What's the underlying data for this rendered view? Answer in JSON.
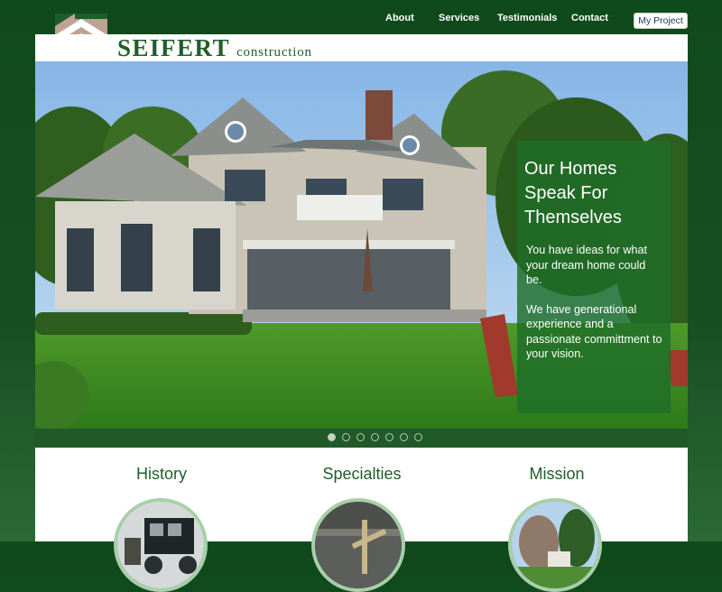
{
  "brand": {
    "name": "SEIFERT",
    "tagline": "construction",
    "logo_icon": "roof-logo-icon",
    "colors": {
      "primary_green": "#1f5f2a",
      "logo_tan": "#bfa392"
    }
  },
  "nav": {
    "items": [
      {
        "label": "About"
      },
      {
        "label": "Services"
      },
      {
        "label": "Testimonials"
      },
      {
        "label": "Contact"
      }
    ],
    "project_button": "My Project"
  },
  "hero": {
    "title": "Our Homes Speak For Themselves",
    "paragraph1": "You have ideas for what your dream home could be.",
    "paragraph2": "We have generational experience and a passionate committment to your vision.",
    "slides": {
      "count": 7,
      "active_index": 0
    }
  },
  "sections": [
    {
      "title": "History",
      "image": "vintage-truck-photo"
    },
    {
      "title": "Specialties",
      "image": "woodwork-photo"
    },
    {
      "title": "Mission",
      "image": "house-landscape-photo"
    }
  ]
}
